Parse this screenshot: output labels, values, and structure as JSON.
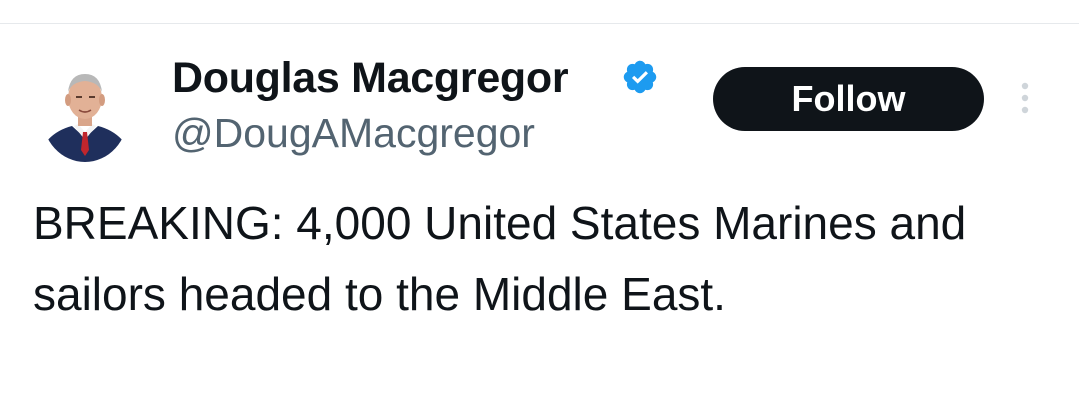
{
  "tweet": {
    "author": {
      "display_name": "Douglas Macgregor",
      "handle": "@DougAMacgregor",
      "verified": true,
      "avatar_icon": "profile-photo-man-in-suit"
    },
    "follow_label": "Follow",
    "more_icon": "more-vertical-icon",
    "text": "BREAKING: 4,000 United States Marines and sailors headed to the Middle East."
  },
  "colors": {
    "text_primary": "#0f1419",
    "text_secondary": "#536471",
    "verified_blue": "#1d9bf0",
    "follow_button_bg": "#0f1419",
    "follow_button_text": "#ffffff"
  }
}
